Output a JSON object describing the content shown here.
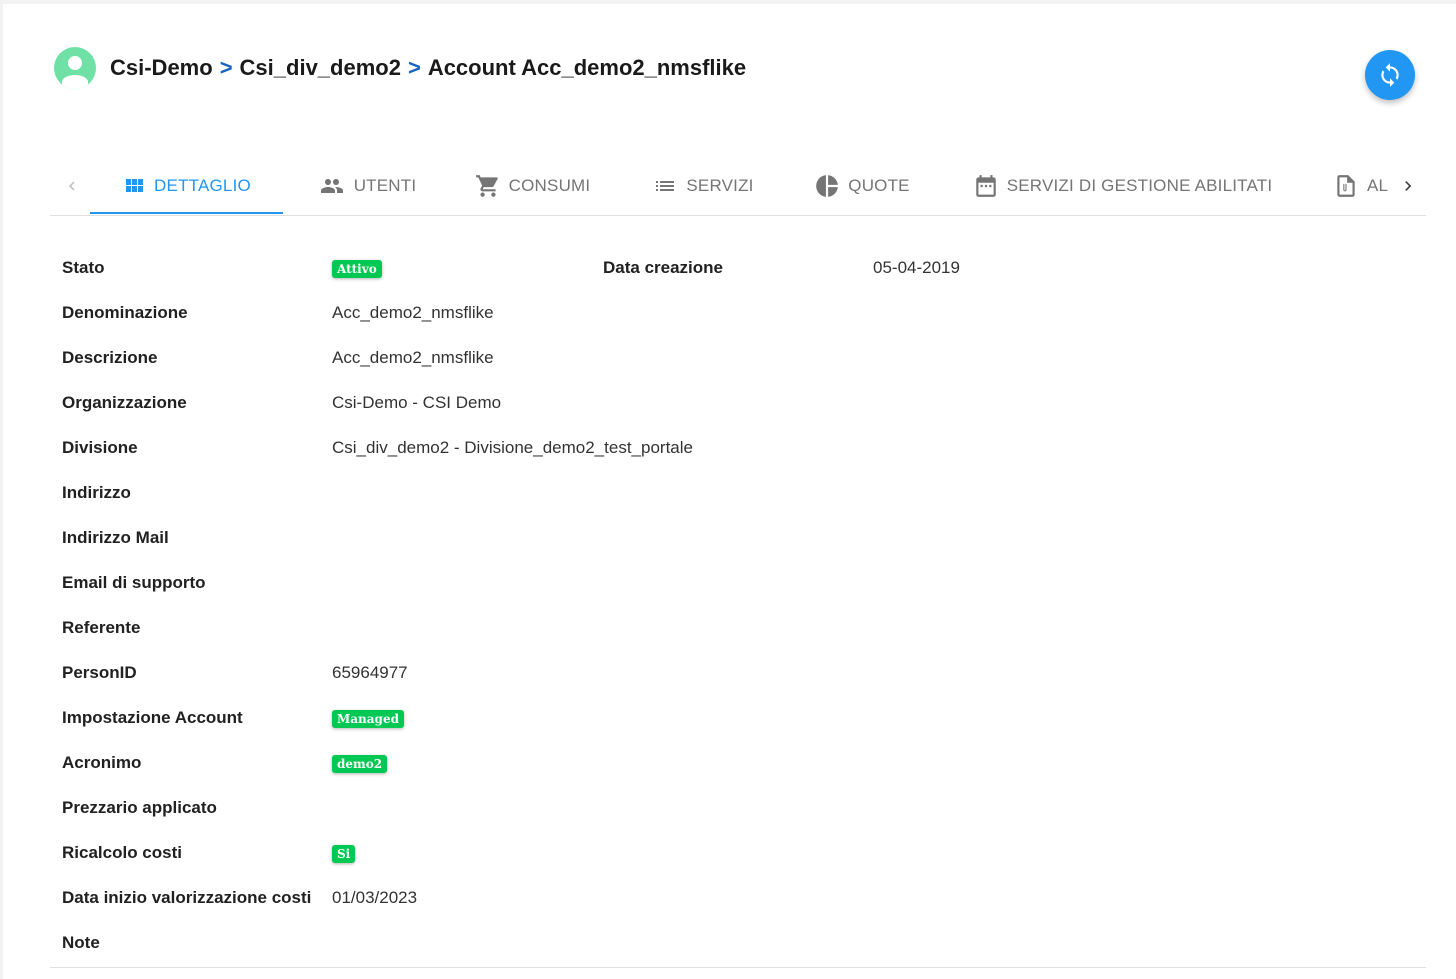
{
  "header": {
    "crumbs": [
      "Csi-Demo",
      "Csi_div_demo2",
      "Account Acc_demo2_nmsflike"
    ],
    "separator": ">"
  },
  "tabs": [
    {
      "label": "DETTAGLIO",
      "icon": "grid-icon",
      "active": true
    },
    {
      "label": "UTENTI",
      "icon": "people-icon",
      "active": false
    },
    {
      "label": "CONSUMI",
      "icon": "cart-icon",
      "active": false
    },
    {
      "label": "SERVIZI",
      "icon": "list-icon",
      "active": false
    },
    {
      "label": "QUOTE",
      "icon": "pie-chart-icon",
      "active": false
    },
    {
      "label": "SERVIZI DI GESTIONE ABILITATI",
      "icon": "calendar-icon",
      "active": false
    },
    {
      "label": "AL",
      "icon": "attachment-icon",
      "active": false
    }
  ],
  "details": {
    "stato_label": "Stato",
    "stato_value": "Attivo",
    "data_creazione_label": "Data creazione",
    "data_creazione_value": "05-04-2019",
    "rows": [
      {
        "label": "Denominazione",
        "value": "Acc_demo2_nmsflike"
      },
      {
        "label": "Descrizione",
        "value": "Acc_demo2_nmsflike"
      },
      {
        "label": "Organizzazione",
        "value": "Csi-Demo - CSI Demo"
      },
      {
        "label": "Divisione",
        "value": "Csi_div_demo2 - Divisione_demo2_test_portale"
      },
      {
        "label": "Indirizzo",
        "value": ""
      },
      {
        "label": "Indirizzo Mail",
        "value": ""
      },
      {
        "label": "Email di supporto",
        "value": ""
      },
      {
        "label": "Referente",
        "value": ""
      },
      {
        "label": "PersonID",
        "value": "65964977"
      },
      {
        "label": "Impostazione Account",
        "badge": "Managed"
      },
      {
        "label": "Acronimo",
        "badge": "demo2"
      },
      {
        "label": "Prezzario applicato",
        "value": ""
      },
      {
        "label": "Ricalcolo costi",
        "badge": "Si"
      },
      {
        "label": "Data inizio valorizzazione costi",
        "value": "01/03/2023"
      },
      {
        "label": "Note",
        "value": ""
      }
    ]
  },
  "colors": {
    "accent": "#2196f3",
    "badge": "#00c853",
    "avatar": "#6fe0a6",
    "crumb_separator": "#1565c0"
  }
}
